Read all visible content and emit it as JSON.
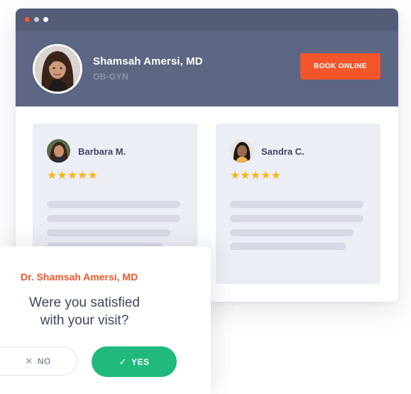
{
  "window": {
    "dots": [
      "red",
      "gray",
      "white"
    ]
  },
  "doctor": {
    "name": "Shamsah Amersi, MD",
    "specialty": "OB-GYN",
    "book_label": "BOOK ONLINE"
  },
  "reviews": [
    {
      "reviewer": "Barbara M.",
      "stars": "★★★★★",
      "rating": 5
    },
    {
      "reviewer": "Sandra C.",
      "stars": "★★★★★",
      "rating": 5
    }
  ],
  "survey": {
    "doctor_name": "Dr. Shamsah Amersi, MD",
    "question_line1": "Were you satisfied",
    "question_line2": "with your visit?",
    "no_label": "NO",
    "yes_label": "YES"
  },
  "colors": {
    "accent": "#f4562b",
    "success": "#21b97e",
    "header": "#5d6683",
    "star": "#f7b51a"
  }
}
